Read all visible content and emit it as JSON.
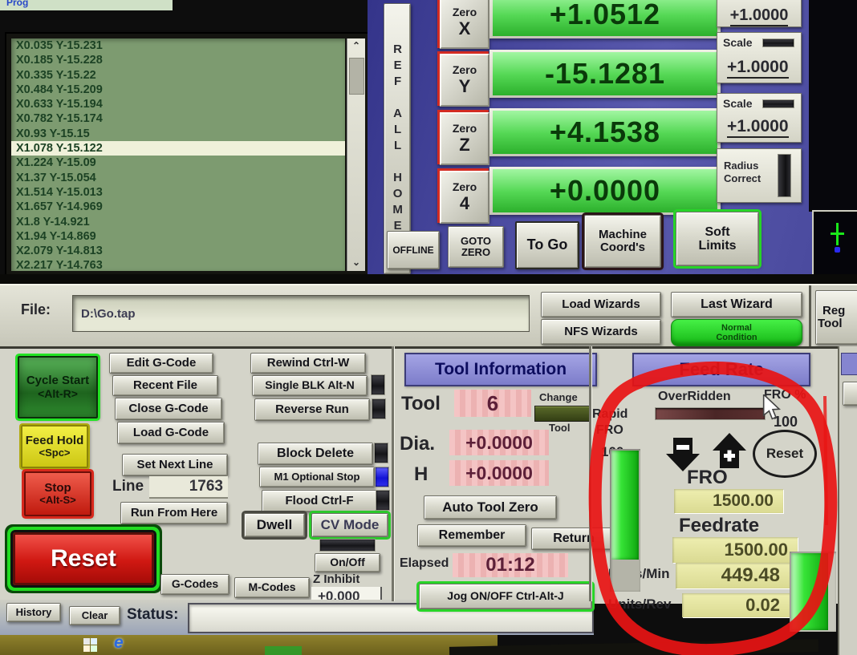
{
  "colors": {
    "annotation": "#e81414",
    "led_on_blue": "#2a2ae8",
    "condition_green": "#2ddb2d",
    "dro_text": "#0a3a0a"
  },
  "top_strip": {
    "partial_text": "Prog"
  },
  "gcode": {
    "lines": [
      "X0.035 Y-15.231",
      "X0.185 Y-15.228",
      "X0.335 Y-15.22",
      "X0.484 Y-15.209",
      "X0.633 Y-15.194",
      "X0.782 Y-15.174",
      "X0.93 Y-15.15",
      "X1.078 Y-15.122",
      "X1.224 Y-15.09",
      "X1.37 Y-15.054",
      "X1.514 Y-15.013",
      "X1.657 Y-14.969",
      "X1.8 Y-14.921",
      "X1.94 Y-14.869",
      "X2.079 Y-14.813",
      "X2.217 Y-14.763"
    ],
    "highlight_index": 7
  },
  "dro_panel": {
    "ref_all_home": "REF ALL HOME",
    "zero_word": "Zero",
    "rows": [
      {
        "axis": "X",
        "value": "+1.0512"
      },
      {
        "axis": "Y",
        "value": "-15.1281"
      },
      {
        "axis": "Z",
        "value": "+4.1538"
      },
      {
        "axis": "4",
        "value": "+0.0000"
      }
    ],
    "scale_label": "Scale",
    "scale_x": "+1.0000",
    "scale_y": "+1.0000",
    "scale_z": "+1.0000",
    "radius_correct_line1": "Radius",
    "radius_correct_line2": "Correct"
  },
  "mode_buttons": {
    "offline": "OFFLINE",
    "goto_zero_line1": "GOTO",
    "goto_zero_line2": "ZERO",
    "to_go": "To Go",
    "machine_coords_line1": "Machine",
    "machine_coords_line2": "Coord's",
    "soft_limits_line1": "Soft",
    "soft_limits_line2": "Limits"
  },
  "file_bar": {
    "label": "File:",
    "path": "D:\\Go.tap"
  },
  "wizards": {
    "load": "Load Wizards",
    "last": "Last Wizard",
    "nfs": "NFS Wizards",
    "condition_line1": "Normal",
    "condition_line2": "Condition"
  },
  "regen_partial": {
    "line1": "Reg",
    "line2": "Tool"
  },
  "run_controls": {
    "cycle_start": "Cycle Start",
    "cycle_start_key": "<Alt-R>",
    "feed_hold": "Feed Hold",
    "feed_hold_key": "<Spc>",
    "stop": "Stop",
    "stop_key": "<Alt-S>",
    "reset": "Reset"
  },
  "file_ops": {
    "edit": "Edit G-Code",
    "recent": "Recent File",
    "close": "Close G-Code",
    "load": "Load G-Code",
    "set_next_line": "Set Next Line",
    "line_label": "Line",
    "line_value": "1763",
    "run_from_here": "Run From Here"
  },
  "toggles": {
    "rewind": "Rewind Ctrl-W",
    "single_blk": "Single BLK Alt-N",
    "reverse_run": "Reverse Run",
    "block_delete": "Block Delete",
    "m1_optional_stop": "M1 Optional Stop",
    "flood": "Flood Ctrl-F",
    "dwell": "Dwell",
    "cv_mode": "CV Mode"
  },
  "code_buttons": {
    "g_codes": "G-Codes",
    "m_codes": "M-Codes",
    "on_off": "On/Off",
    "z_inhibit_label": "Z Inhibit",
    "z_inhibit_value": "+0.000"
  },
  "status_bar": {
    "history": "History",
    "clear": "Clear",
    "label": "Status:"
  },
  "tool_info": {
    "title": "Tool Information",
    "tool_label": "Tool",
    "tool_value": "6",
    "change_line1": "Change",
    "change_line2": "Tool",
    "dia_label": "Dia.",
    "dia_value": "+0.0000",
    "h_label": "H",
    "h_value": "+0.0000",
    "auto_tool_zero": "Auto Tool Zero",
    "remember": "Remember",
    "return": "Return",
    "elapsed_label": "Elapsed",
    "elapsed_value": "01:12",
    "jog": "Jog ON/OFF Ctrl-Alt-J"
  },
  "feed_rate": {
    "title": "Feed Rate",
    "overridden": "OverRidden",
    "fro_pct_label": "FRO %",
    "fro_pct_value": "100",
    "rapid_line1": "Rapid",
    "rapid_line2": "FRO",
    "rapid_value": "100",
    "reset": "Reset",
    "fro_label": "FRO",
    "fro_value": "1500.00",
    "feedrate_label": "Feedrate",
    "feedrate_value": "1500.00",
    "units_min_label": "Units/Min",
    "units_min_value": "449.48",
    "units_rev_label": "Units/Rev",
    "units_rev_value": "0.02"
  }
}
